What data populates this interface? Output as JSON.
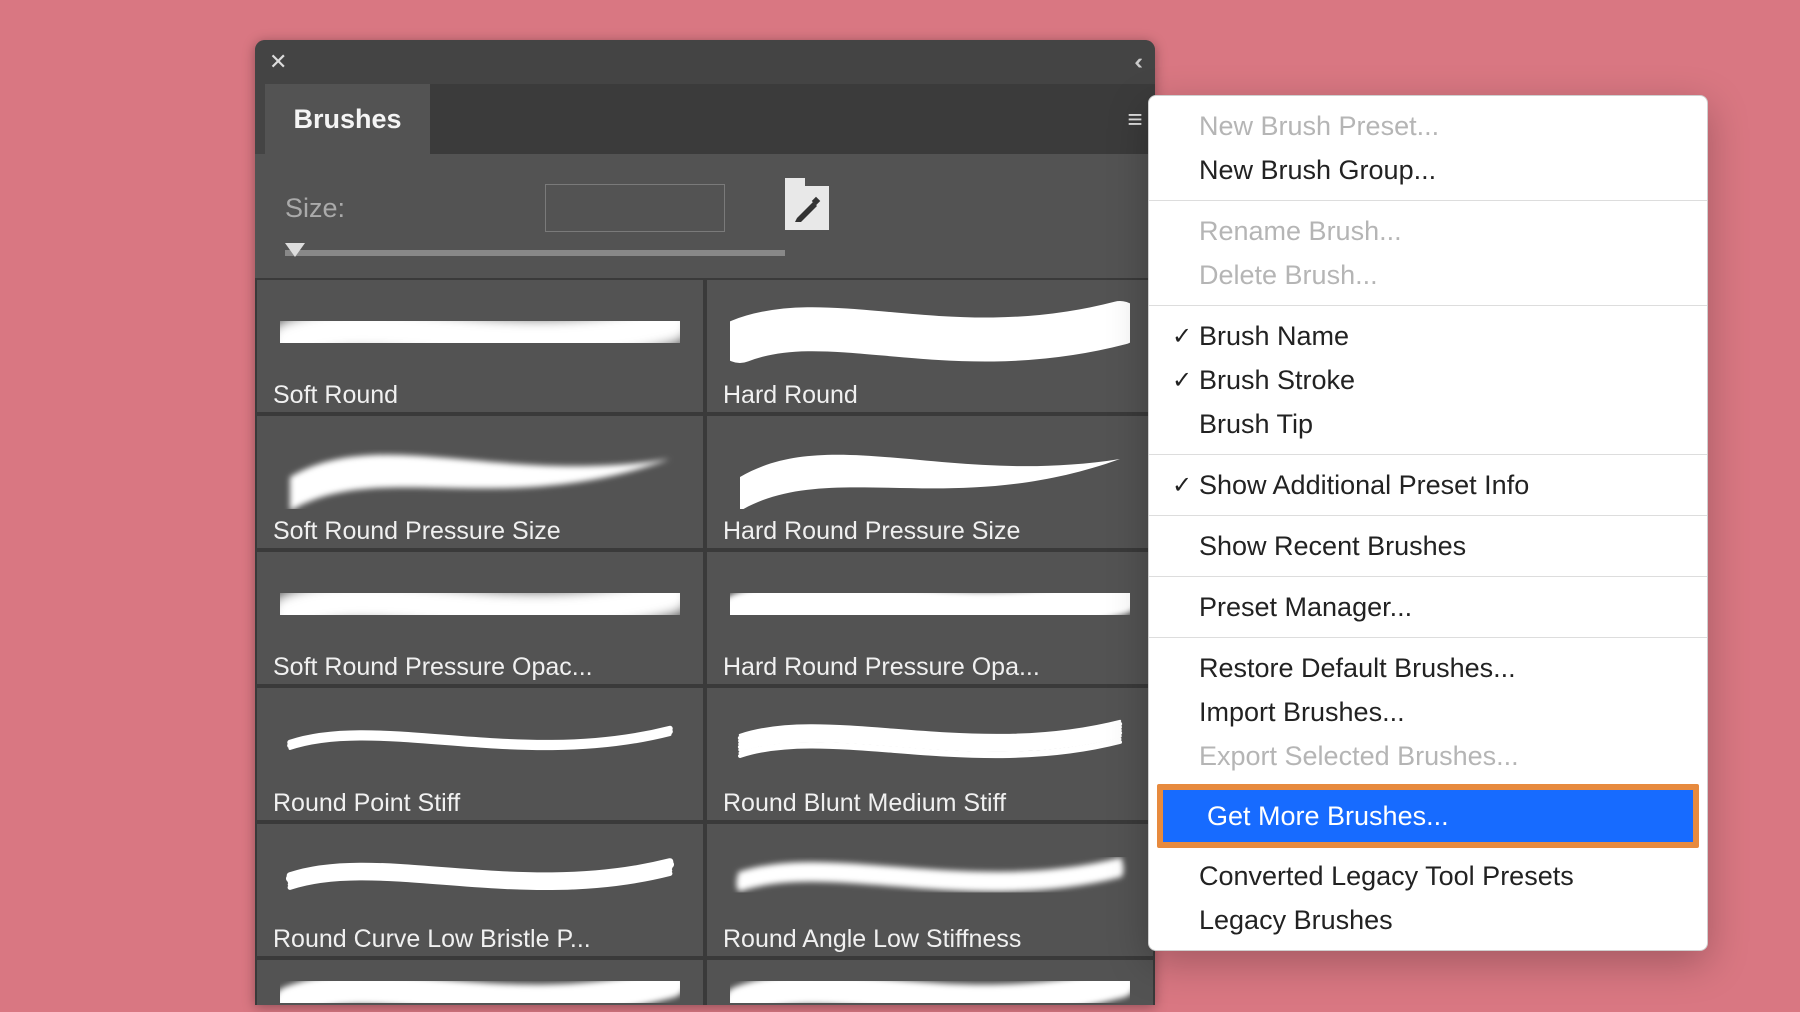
{
  "panel": {
    "tab_label": "Brushes",
    "size_label": "Size:",
    "brushes": [
      {
        "name": "Soft Round",
        "stroke": "soft-round"
      },
      {
        "name": "Hard Round",
        "stroke": "hard-round"
      },
      {
        "name": "Soft Round Pressure Size",
        "stroke": "soft-round-press-size"
      },
      {
        "name": "Hard Round Pressure Size",
        "stroke": "hard-round-press-size"
      },
      {
        "name": "Soft Round Pressure Opac...",
        "stroke": "soft-round-press-opac"
      },
      {
        "name": "Hard Round Pressure Opa...",
        "stroke": "hard-round-press-opac"
      },
      {
        "name": "Round Point Stiff",
        "stroke": "point-stiff"
      },
      {
        "name": "Round Blunt Medium Stiff",
        "stroke": "blunt-medium"
      },
      {
        "name": "Round Curve Low Bristle P...",
        "stroke": "curve-low-bristle"
      },
      {
        "name": "Round Angle Low Stiffness",
        "stroke": "angle-low-stiff"
      }
    ]
  },
  "menu": {
    "items": [
      {
        "label": "New Brush Preset...",
        "disabled": true
      },
      {
        "label": "New Brush Group..."
      },
      {
        "sep": true
      },
      {
        "label": "Rename Brush...",
        "disabled": true
      },
      {
        "label": "Delete Brush...",
        "disabled": true
      },
      {
        "sep": true
      },
      {
        "label": "Brush Name",
        "checked": true
      },
      {
        "label": "Brush Stroke",
        "checked": true
      },
      {
        "label": "Brush Tip"
      },
      {
        "sep": true
      },
      {
        "label": "Show Additional Preset Info",
        "checked": true
      },
      {
        "sep": true
      },
      {
        "label": "Show Recent Brushes"
      },
      {
        "sep": true
      },
      {
        "label": "Preset Manager..."
      },
      {
        "sep": true
      },
      {
        "label": "Restore Default Brushes..."
      },
      {
        "label": "Import Brushes..."
      },
      {
        "label": "Export Selected Brushes...",
        "disabled": true
      },
      {
        "highlight": true,
        "label": "Get More Brushes..."
      },
      {
        "label": "Converted Legacy Tool Presets"
      },
      {
        "label": "Legacy Brushes"
      }
    ]
  }
}
